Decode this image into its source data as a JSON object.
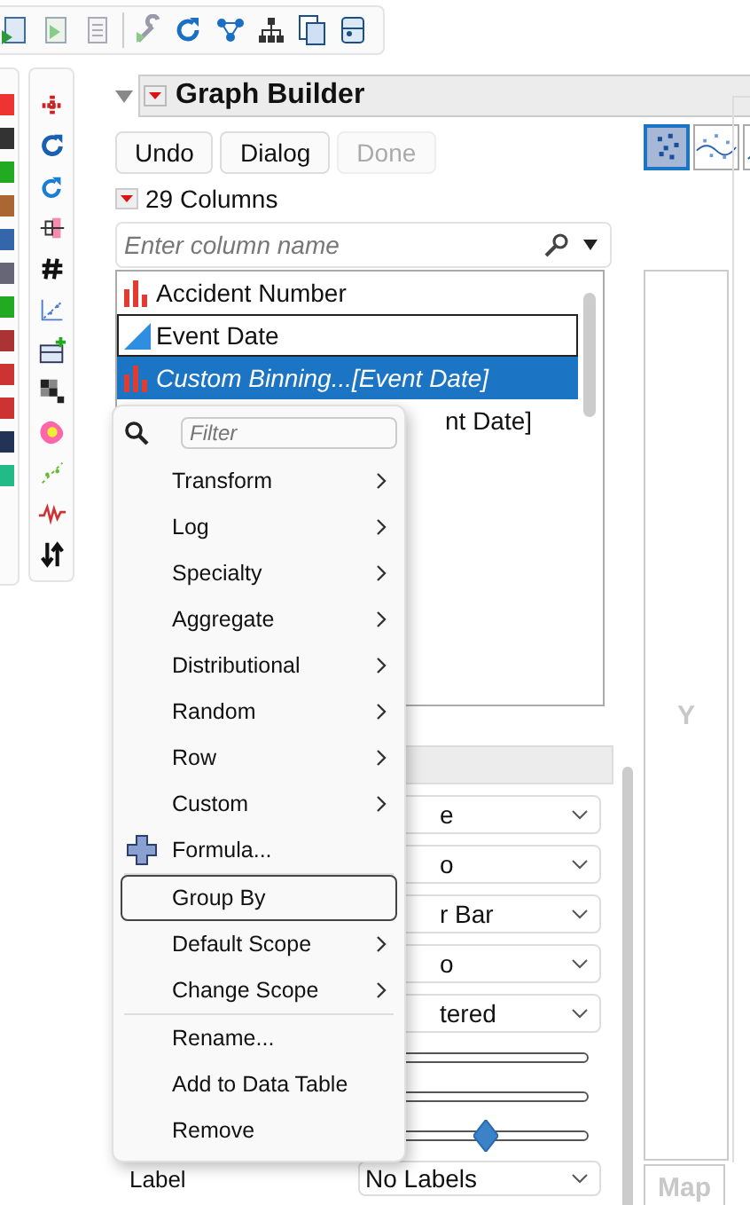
{
  "panel": {
    "title": "Graph Builder",
    "expanded": true,
    "buttons": [
      {
        "label": "Undo",
        "disabled": false
      },
      {
        "label": "Dialog",
        "disabled": false
      },
      {
        "label": "Done",
        "disabled": true
      }
    ]
  },
  "columns": {
    "count_label": "29 Columns",
    "search": {
      "placeholder": "Enter column name"
    },
    "items": [
      {
        "name": "Accident Number",
        "kind": "nominal",
        "virtual": false,
        "selected": false,
        "focused": false
      },
      {
        "name": "Event Date",
        "kind": "continuous",
        "virtual": false,
        "selected": false,
        "focused": true
      },
      {
        "name": "Custom Binning...[Event Date]",
        "kind": "nominal",
        "virtual": true,
        "selected": true,
        "focused": false
      },
      {
        "name": "nt Date]",
        "virtual": false,
        "selected": false,
        "focused": false
      }
    ]
  },
  "context_menu": {
    "filter": {
      "placeholder": "Filter"
    },
    "items": [
      {
        "kind": "item",
        "label": "Transform",
        "submenu": true,
        "focused": false
      },
      {
        "kind": "item",
        "label": "Log",
        "submenu": true,
        "focused": false
      },
      {
        "kind": "item",
        "label": "Specialty",
        "submenu": true,
        "focused": false
      },
      {
        "kind": "item",
        "label": "Aggregate",
        "submenu": true,
        "focused": false
      },
      {
        "kind": "item",
        "label": "Distributional",
        "submenu": true,
        "focused": false
      },
      {
        "kind": "item",
        "label": "Random",
        "submenu": true,
        "focused": false
      },
      {
        "kind": "item",
        "label": "Row",
        "submenu": true,
        "focused": false
      },
      {
        "kind": "item",
        "label": "Custom",
        "submenu": true,
        "focused": false
      },
      {
        "kind": "formula",
        "label": "Formula...",
        "submenu": false,
        "focused": false
      },
      {
        "kind": "separator"
      },
      {
        "kind": "item",
        "label": "Group By",
        "submenu": false,
        "focused": true
      },
      {
        "kind": "item",
        "label": "Default Scope",
        "submenu": true,
        "focused": false
      },
      {
        "kind": "item",
        "label": "Change Scope",
        "submenu": true,
        "focused": false
      },
      {
        "kind": "separator"
      },
      {
        "kind": "item",
        "label": "Rename...",
        "submenu": false,
        "focused": false
      },
      {
        "kind": "item",
        "label": "Add to Data Table",
        "submenu": false,
        "focused": false
      },
      {
        "kind": "item",
        "label": "Remove",
        "submenu": false,
        "focused": false
      }
    ]
  },
  "properties": {
    "rows": [
      {
        "kind": "header"
      },
      {
        "kind": "dropdown",
        "value": "e"
      },
      {
        "kind": "dropdown",
        "value": "o"
      },
      {
        "kind": "dropdown",
        "value": "r Bar"
      },
      {
        "kind": "dropdown",
        "value": "o"
      },
      {
        "kind": "dropdown",
        "value": "tered"
      },
      {
        "kind": "slider"
      },
      {
        "kind": "slider"
      },
      {
        "kind": "slider",
        "level": 0.55
      },
      {
        "kind": "dropdown",
        "label": "Label",
        "value": "No Labels"
      }
    ]
  },
  "graph": {
    "element_buttons": [
      {
        "kind": "points",
        "selected": true
      },
      {
        "kind": "smoother",
        "selected": false
      },
      {
        "kind": "line",
        "selected": false
      }
    ],
    "y_zone": "Y",
    "map_zone": "Map"
  }
}
